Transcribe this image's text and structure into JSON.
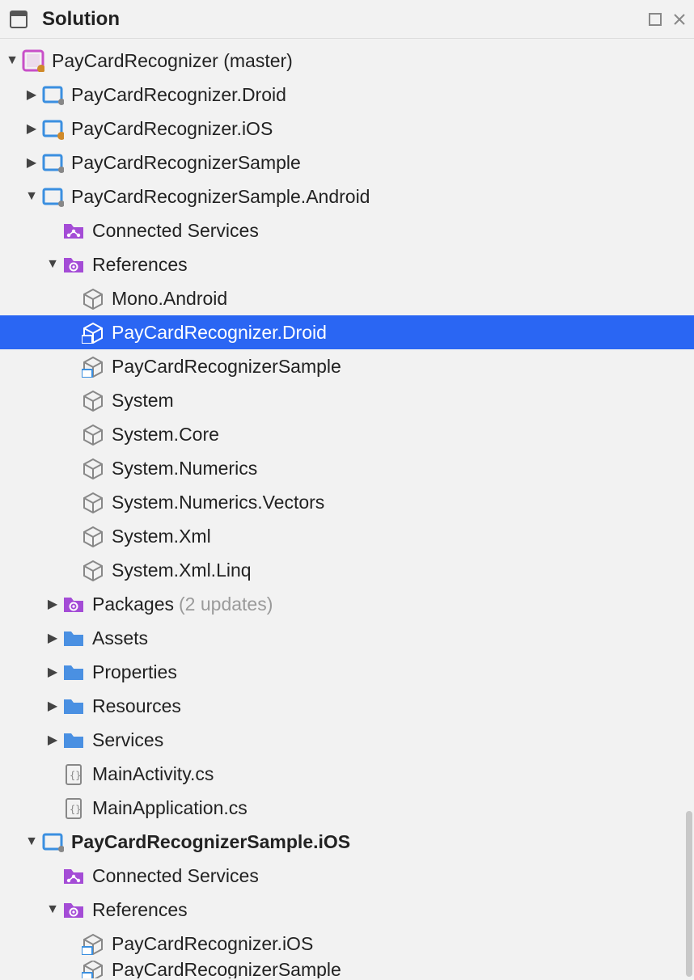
{
  "panel": {
    "title": "Solution"
  },
  "solution": {
    "name": "PayCardRecognizer",
    "branch": "(master)"
  },
  "projects": {
    "droid": "PayCardRecognizer.Droid",
    "ios": "PayCardRecognizer.iOS",
    "sample": "PayCardRecognizerSample",
    "sample_android": "PayCardRecognizerSample.Android",
    "sample_ios": "PayCardRecognizerSample.iOS"
  },
  "android": {
    "connected_services": "Connected Services",
    "references_label": "References",
    "references": {
      "mono_android": "Mono.Android",
      "paycard_droid": "PayCardRecognizer.Droid",
      "paycard_sample": "PayCardRecognizerSample",
      "system": "System",
      "system_core": "System.Core",
      "system_numerics": "System.Numerics",
      "system_numerics_vectors": "System.Numerics.Vectors",
      "system_xml": "System.Xml",
      "system_xml_linq": "System.Xml.Linq"
    },
    "packages_label": "Packages",
    "packages_suffix": "(2 updates)",
    "folders": {
      "assets": "Assets",
      "properties": "Properties",
      "resources": "Resources",
      "services": "Services"
    },
    "files": {
      "main_activity": "MainActivity.cs",
      "main_application": "MainApplication.cs"
    }
  },
  "ios": {
    "connected_services": "Connected Services",
    "references_label": "References",
    "references": {
      "paycard_ios": "PayCardRecognizer.iOS",
      "paycard_sample": "PayCardRecognizerSample"
    }
  }
}
